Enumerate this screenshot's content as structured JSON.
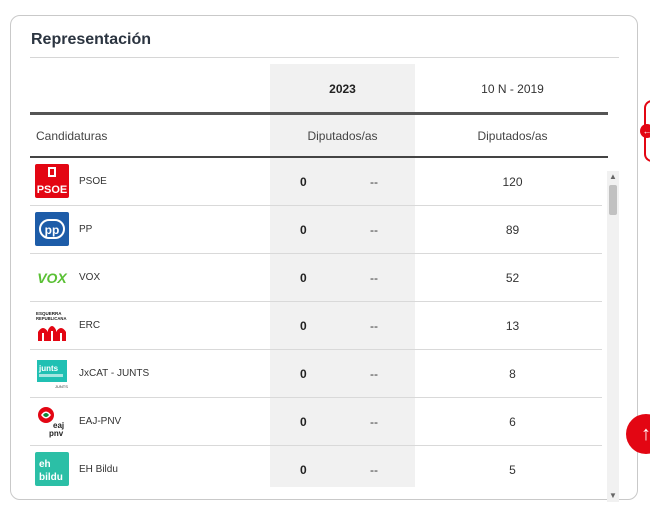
{
  "section": {
    "title": "Representación"
  },
  "table": {
    "year_2023": "2023",
    "year_2019": "10 N - 2019",
    "col_candidaturas": "Candidaturas",
    "col_dip_2023": "Diputados/as",
    "col_dip_2019": "Diputados/as",
    "rows": [
      {
        "party": "PSOE",
        "logo_text": "PSOE",
        "seats_2023": "0",
        "diff": "--",
        "seats_2019": "120"
      },
      {
        "party": "PP",
        "logo_text": "pp",
        "seats_2023": "0",
        "diff": "--",
        "seats_2019": "89"
      },
      {
        "party": "VOX",
        "logo_text": "VOX",
        "seats_2023": "0",
        "diff": "--",
        "seats_2019": "52"
      },
      {
        "party": "ERC",
        "logo_text": "ESQUERRA REPUBLICANA",
        "seats_2023": "0",
        "diff": "--",
        "seats_2019": "13"
      },
      {
        "party": "JxCAT - JUNTS",
        "logo_text": "junts",
        "seats_2023": "0",
        "diff": "--",
        "seats_2019": "8"
      },
      {
        "party": "EAJ-PNV",
        "logo_text": "eaj pnv",
        "seats_2023": "0",
        "diff": "--",
        "seats_2019": "6"
      },
      {
        "party": "EH Bildu",
        "logo_text": "eh bildu",
        "seats_2023": "0",
        "diff": "--",
        "seats_2019": "5"
      }
    ]
  },
  "colors": {
    "accent": "#e30613",
    "psoe": "#e30613",
    "pp": "#1d5ca8",
    "vox": "#5ac035",
    "erc": "#e30613",
    "junts": "#20c0b3",
    "pnv": "#0b8a3a",
    "bildu": "#2bbfa6"
  },
  "icons": {
    "scroll_up": "triangle-up-icon",
    "scroll_down": "triangle-down-icon",
    "to_top": "arrow-up-icon",
    "side_tab": "arrow-left-icon"
  }
}
